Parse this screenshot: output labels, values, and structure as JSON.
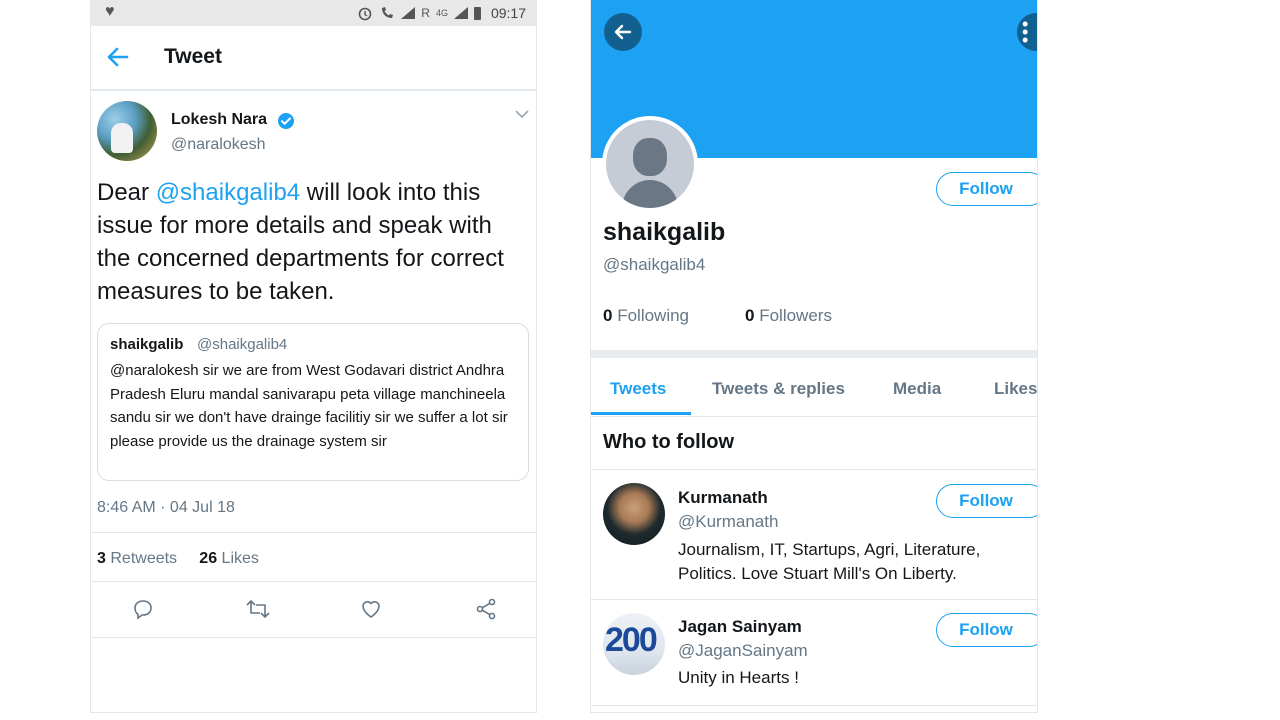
{
  "status_bar": {
    "time": "09:17",
    "network": "4G",
    "roaming": "R"
  },
  "tweet_screen": {
    "header_title": "Tweet",
    "author": {
      "name": "Lokesh Nara",
      "handle": "@naralokesh"
    },
    "text_prefix": "Dear ",
    "text_mention": "@shaikgalib4",
    "text_rest": " will look into this issue for more details and speak with the concerned departments for correct measures to be taken.",
    "quote": {
      "name": "shaikgalib",
      "handle": "@shaikgalib4",
      "text": "@naralokesh  sir we are from West Godavari district Andhra Pradesh Eluru mandal sanivarapu peta village manchineela sandu sir we don't have drainge facilitiy sir we suffer a lot sir please provide us the drainage system sir"
    },
    "timestamp": "8:46 AM · 04 Jul 18",
    "retweets_count": "3",
    "retweets_label": "Retweets",
    "likes_count": "26",
    "likes_label": "Likes",
    "actions": [
      "reply-icon",
      "retweet-icon",
      "like-icon",
      "share-icon"
    ]
  },
  "profile_screen": {
    "banner_color": "#1da1f2",
    "name": "shaikgalib",
    "handle": "@shaikgalib4",
    "follow_label": "Follow",
    "following_count": "0",
    "following_label": "Following",
    "followers_count": "0",
    "followers_label": "Followers",
    "tabs": [
      "Tweets",
      "Tweets & replies",
      "Media",
      "Likes"
    ],
    "active_tab": "Tweets",
    "who_to_follow_title": "Who to follow",
    "suggestions": [
      {
        "name": "Kurmanath",
        "handle": "@Kurmanath",
        "bio": "Journalism, IT, Startups, Agri, Literature, Politics. Love Stuart Mill's On Liberty.",
        "follow_label": "Follow"
      },
      {
        "name": "Jagan Sainyam",
        "handle": "@JaganSainyam",
        "bio": "Unity in Hearts !",
        "follow_label": "Follow",
        "avatar_text": "200"
      }
    ]
  },
  "colors": {
    "accent": "#1da1f2",
    "secondary_text": "#657786",
    "primary_text": "#14171a"
  }
}
